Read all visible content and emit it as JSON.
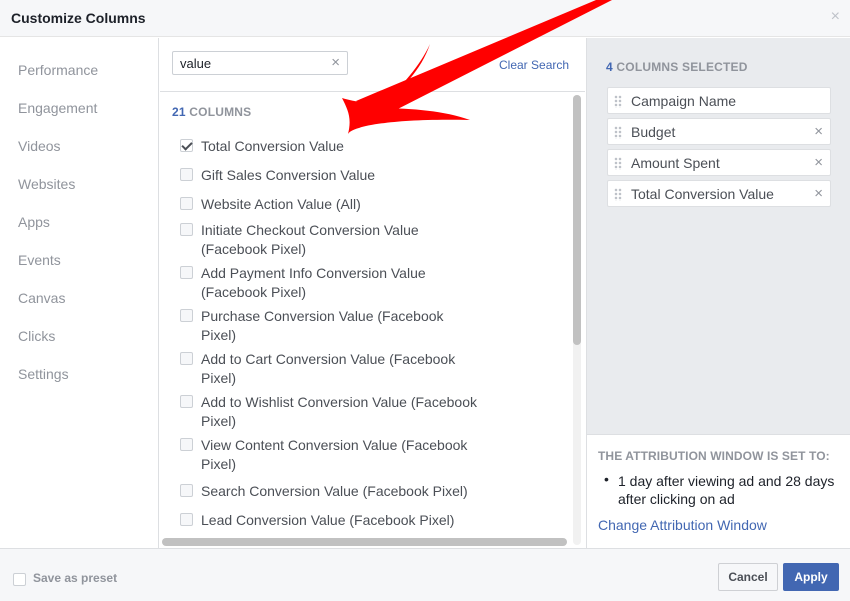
{
  "dialog": {
    "title": "Customize Columns",
    "close_glyph": "×"
  },
  "sidebar": {
    "items": [
      {
        "label": "Performance"
      },
      {
        "label": "Engagement"
      },
      {
        "label": "Videos"
      },
      {
        "label": "Websites"
      },
      {
        "label": "Apps"
      },
      {
        "label": "Events"
      },
      {
        "label": "Canvas"
      },
      {
        "label": "Clicks"
      },
      {
        "label": "Settings"
      }
    ]
  },
  "search": {
    "value": "value",
    "clear_glyph": "×",
    "clear_label": "Clear Search"
  },
  "columns": {
    "count": "21",
    "count_suffix": "COLUMNS",
    "options": [
      {
        "label": "Total Conversion Value",
        "checked": true
      },
      {
        "label": "Gift Sales Conversion Value",
        "checked": false
      },
      {
        "label": "Website Action Value (All)",
        "checked": false
      },
      {
        "label": "Initiate Checkout Conversion Value (Facebook Pixel)",
        "checked": false
      },
      {
        "label": "Add Payment Info Conversion Value (Facebook Pixel)",
        "checked": false
      },
      {
        "label": "Purchase Conversion Value (Facebook Pixel)",
        "checked": false
      },
      {
        "label": "Add to Cart Conversion Value (Facebook Pixel)",
        "checked": false
      },
      {
        "label": "Add to Wishlist Conversion Value (Facebook Pixel)",
        "checked": false
      },
      {
        "label": "View Content Conversion Value (Facebook Pixel)",
        "checked": false
      },
      {
        "label": "Search Conversion Value (Facebook Pixel)",
        "checked": false
      },
      {
        "label": "Lead Conversion Value (Facebook Pixel)",
        "checked": false
      }
    ]
  },
  "selected": {
    "count": "4",
    "count_suffix": "COLUMNS SELECTED",
    "items": [
      {
        "label": "Campaign Name",
        "removable": false
      },
      {
        "label": "Budget",
        "removable": true
      },
      {
        "label": "Amount Spent",
        "removable": true
      },
      {
        "label": "Total Conversion Value",
        "removable": true
      }
    ],
    "remove_glyph": "×"
  },
  "attribution": {
    "heading": "THE ATTRIBUTION WINDOW IS SET TO:",
    "bullet": "•",
    "text": "1 day after viewing ad and 28 days after clicking on ad",
    "link": "Change Attribution Window"
  },
  "footer": {
    "preset_label": "Save as preset",
    "cancel_label": "Cancel",
    "apply_label": "Apply"
  },
  "colors": {
    "accent": "#4267b2",
    "annotation_arrow": "#ff0000"
  }
}
